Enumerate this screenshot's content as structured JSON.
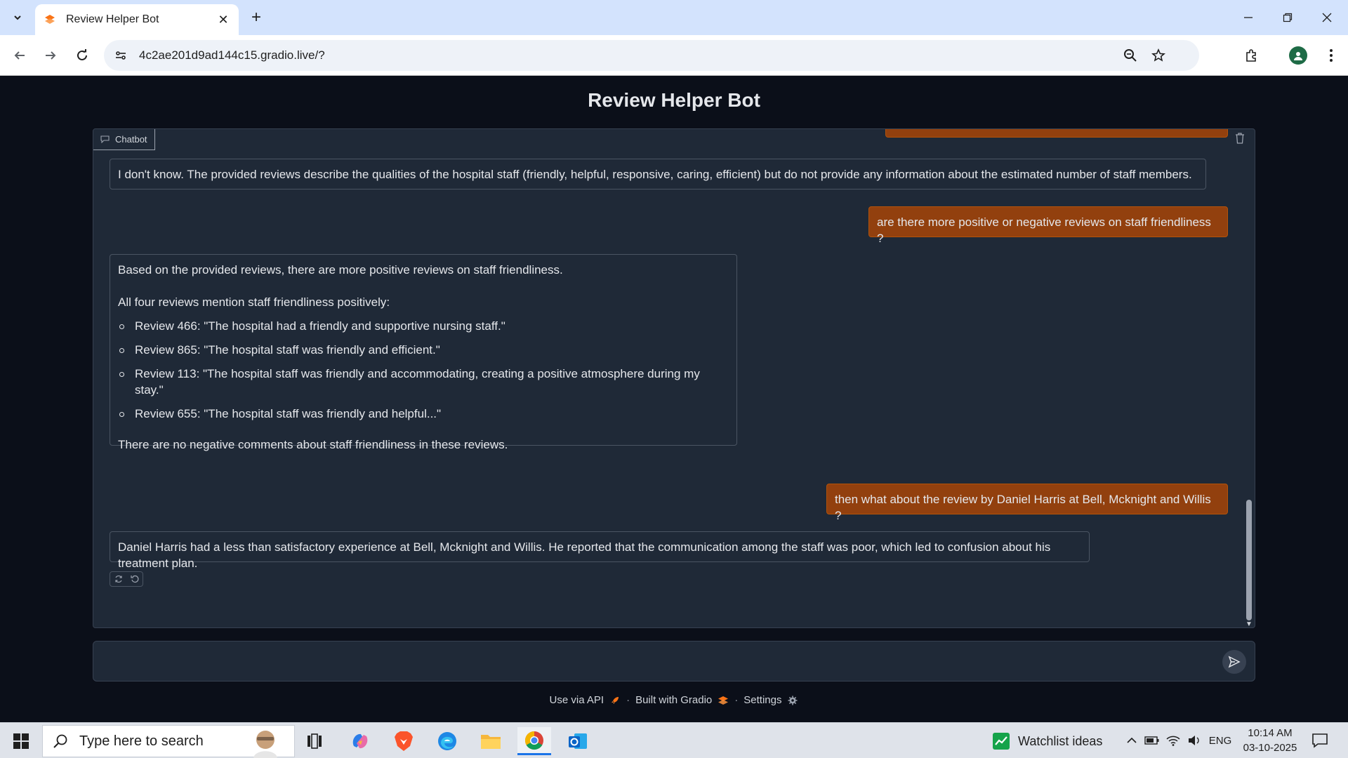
{
  "browser": {
    "tab_title": "Review Helper Bot",
    "url": "4c2ae201d9ad144c15.gradio.live/?"
  },
  "page": {
    "title": "Review Helper Bot",
    "chatbot_label": "Chatbot"
  },
  "messages": {
    "m1_bot": "I don't know. The provided reviews describe the qualities of the hospital staff (friendly, helpful, responsive, caring, efficient) but do not provide any information about the estimated number of staff members.",
    "m2_user": "are there more positive or negative reviews on staff friendliness ?",
    "m3_bot": {
      "intro": "Based on the provided reviews, there are more positive reviews on staff friendliness.",
      "lead": "All four reviews mention staff friendliness positively:",
      "items": [
        "Review 466: \"The hospital had a friendly and supportive nursing staff.\"",
        "Review 865: \"The hospital staff was friendly and efficient.\"",
        "Review 113: \"The hospital staff was friendly and accommodating, creating a positive atmosphere during my stay.\"",
        "Review 655: \"The hospital staff was friendly and helpful...\""
      ],
      "outro": "There are no negative comments about staff friendliness in these reviews."
    },
    "m4_user": "then what about the review by Daniel Harris at Bell, Mcknight and Willis ?",
    "m5_bot": "Daniel Harris had a less than satisfactory experience at Bell, Mcknight and Willis. He reported that the communication among the staff was poor, which led to confusion about his treatment plan."
  },
  "input": {
    "value": "",
    "placeholder": ""
  },
  "footer": {
    "api": "Use via API",
    "built": "Built with Gradio",
    "settings": "Settings",
    "separator": "·"
  },
  "taskbar": {
    "search_placeholder": "Type here to search",
    "watchlist": "Watchlist ideas",
    "language": "ENG",
    "time": "10:14 AM",
    "date": "03-10-2025"
  },
  "colors": {
    "user_bubble": "#92400e",
    "bot_bubble": "#1f2937",
    "page_bg": "#0b0f19",
    "gradio_orange": "#f97316"
  }
}
